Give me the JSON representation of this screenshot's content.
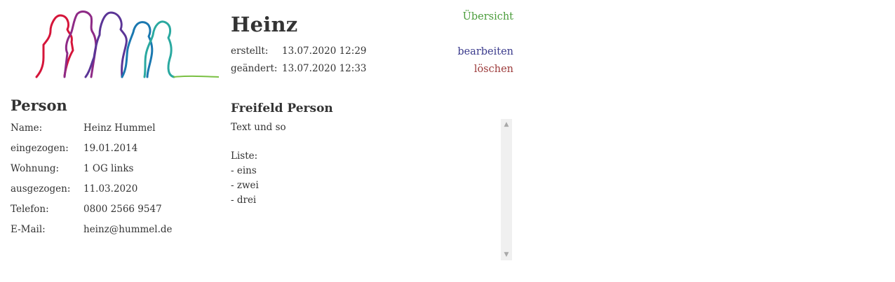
{
  "header": {
    "title": "Heinz",
    "created_label": "erstellt:",
    "created_value": "13.07.2020 12:29",
    "changed_label": "geändert:",
    "changed_value": "13.07.2020 12:33"
  },
  "nav": {
    "overview": "Übersicht",
    "edit": "bearbeiten",
    "delete": "löschen"
  },
  "person": {
    "heading": "Person",
    "rows": [
      {
        "label": "Name:",
        "value": "Heinz Hummel"
      },
      {
        "label": "eingezogen:",
        "value": "19.01.2014"
      },
      {
        "label": "Wohnung:",
        "value": "1 OG links"
      },
      {
        "label": "ausgezogen:",
        "value": "11.03.2020"
      },
      {
        "label": "Telefon:",
        "value": "0800 2566 9547"
      },
      {
        "label": "E-Mail:",
        "value": "heinz@hummel.de"
      }
    ]
  },
  "freefield": {
    "heading": "Freifeld Person",
    "text": "Text und so\n\nListe:\n- eins\n- zwei\n- drei"
  },
  "icons": {
    "logo": "people-silhouettes-logo",
    "scroll_up": "chevron-up-icon",
    "scroll_down": "chevron-down-icon"
  },
  "colors": {
    "text": "#333333",
    "overview_link": "#4a9c3a",
    "edit_link": "#3a3a8c",
    "delete_link": "#9c3a3a"
  }
}
